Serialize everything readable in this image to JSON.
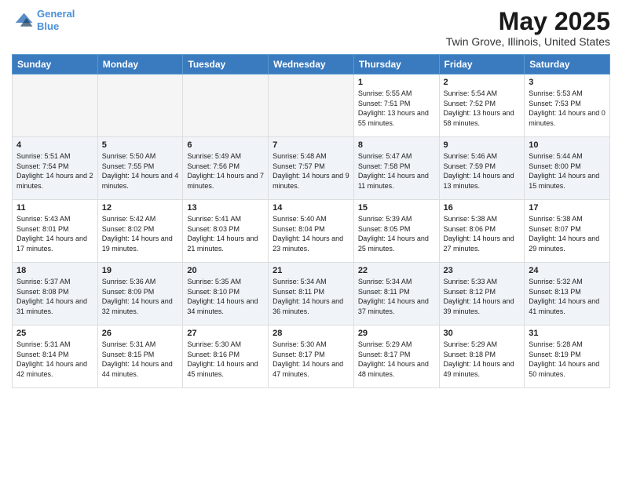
{
  "header": {
    "logo_line1": "General",
    "logo_line2": "Blue",
    "title": "May 2025",
    "subtitle": "Twin Grove, Illinois, United States"
  },
  "weekdays": [
    "Sunday",
    "Monday",
    "Tuesday",
    "Wednesday",
    "Thursday",
    "Friday",
    "Saturday"
  ],
  "weeks": [
    [
      {
        "day": "",
        "empty": true
      },
      {
        "day": "",
        "empty": true
      },
      {
        "day": "",
        "empty": true
      },
      {
        "day": "",
        "empty": true
      },
      {
        "day": "1",
        "sunrise": "5:55 AM",
        "sunset": "7:51 PM",
        "daylight": "13 hours and 55 minutes."
      },
      {
        "day": "2",
        "sunrise": "5:54 AM",
        "sunset": "7:52 PM",
        "daylight": "13 hours and 58 minutes."
      },
      {
        "day": "3",
        "sunrise": "5:53 AM",
        "sunset": "7:53 PM",
        "daylight": "14 hours and 0 minutes."
      }
    ],
    [
      {
        "day": "4",
        "sunrise": "5:51 AM",
        "sunset": "7:54 PM",
        "daylight": "14 hours and 2 minutes."
      },
      {
        "day": "5",
        "sunrise": "5:50 AM",
        "sunset": "7:55 PM",
        "daylight": "14 hours and 4 minutes."
      },
      {
        "day": "6",
        "sunrise": "5:49 AM",
        "sunset": "7:56 PM",
        "daylight": "14 hours and 7 minutes."
      },
      {
        "day": "7",
        "sunrise": "5:48 AM",
        "sunset": "7:57 PM",
        "daylight": "14 hours and 9 minutes."
      },
      {
        "day": "8",
        "sunrise": "5:47 AM",
        "sunset": "7:58 PM",
        "daylight": "14 hours and 11 minutes."
      },
      {
        "day": "9",
        "sunrise": "5:46 AM",
        "sunset": "7:59 PM",
        "daylight": "14 hours and 13 minutes."
      },
      {
        "day": "10",
        "sunrise": "5:44 AM",
        "sunset": "8:00 PM",
        "daylight": "14 hours and 15 minutes."
      }
    ],
    [
      {
        "day": "11",
        "sunrise": "5:43 AM",
        "sunset": "8:01 PM",
        "daylight": "14 hours and 17 minutes."
      },
      {
        "day": "12",
        "sunrise": "5:42 AM",
        "sunset": "8:02 PM",
        "daylight": "14 hours and 19 minutes."
      },
      {
        "day": "13",
        "sunrise": "5:41 AM",
        "sunset": "8:03 PM",
        "daylight": "14 hours and 21 minutes."
      },
      {
        "day": "14",
        "sunrise": "5:40 AM",
        "sunset": "8:04 PM",
        "daylight": "14 hours and 23 minutes."
      },
      {
        "day": "15",
        "sunrise": "5:39 AM",
        "sunset": "8:05 PM",
        "daylight": "14 hours and 25 minutes."
      },
      {
        "day": "16",
        "sunrise": "5:38 AM",
        "sunset": "8:06 PM",
        "daylight": "14 hours and 27 minutes."
      },
      {
        "day": "17",
        "sunrise": "5:38 AM",
        "sunset": "8:07 PM",
        "daylight": "14 hours and 29 minutes."
      }
    ],
    [
      {
        "day": "18",
        "sunrise": "5:37 AM",
        "sunset": "8:08 PM",
        "daylight": "14 hours and 31 minutes."
      },
      {
        "day": "19",
        "sunrise": "5:36 AM",
        "sunset": "8:09 PM",
        "daylight": "14 hours and 32 minutes."
      },
      {
        "day": "20",
        "sunrise": "5:35 AM",
        "sunset": "8:10 PM",
        "daylight": "14 hours and 34 minutes."
      },
      {
        "day": "21",
        "sunrise": "5:34 AM",
        "sunset": "8:11 PM",
        "daylight": "14 hours and 36 minutes."
      },
      {
        "day": "22",
        "sunrise": "5:34 AM",
        "sunset": "8:11 PM",
        "daylight": "14 hours and 37 minutes."
      },
      {
        "day": "23",
        "sunrise": "5:33 AM",
        "sunset": "8:12 PM",
        "daylight": "14 hours and 39 minutes."
      },
      {
        "day": "24",
        "sunrise": "5:32 AM",
        "sunset": "8:13 PM",
        "daylight": "14 hours and 41 minutes."
      }
    ],
    [
      {
        "day": "25",
        "sunrise": "5:31 AM",
        "sunset": "8:14 PM",
        "daylight": "14 hours and 42 minutes."
      },
      {
        "day": "26",
        "sunrise": "5:31 AM",
        "sunset": "8:15 PM",
        "daylight": "14 hours and 44 minutes."
      },
      {
        "day": "27",
        "sunrise": "5:30 AM",
        "sunset": "8:16 PM",
        "daylight": "14 hours and 45 minutes."
      },
      {
        "day": "28",
        "sunrise": "5:30 AM",
        "sunset": "8:17 PM",
        "daylight": "14 hours and 47 minutes."
      },
      {
        "day": "29",
        "sunrise": "5:29 AM",
        "sunset": "8:17 PM",
        "daylight": "14 hours and 48 minutes."
      },
      {
        "day": "30",
        "sunrise": "5:29 AM",
        "sunset": "8:18 PM",
        "daylight": "14 hours and 49 minutes."
      },
      {
        "day": "31",
        "sunrise": "5:28 AM",
        "sunset": "8:19 PM",
        "daylight": "14 hours and 50 minutes."
      }
    ]
  ]
}
